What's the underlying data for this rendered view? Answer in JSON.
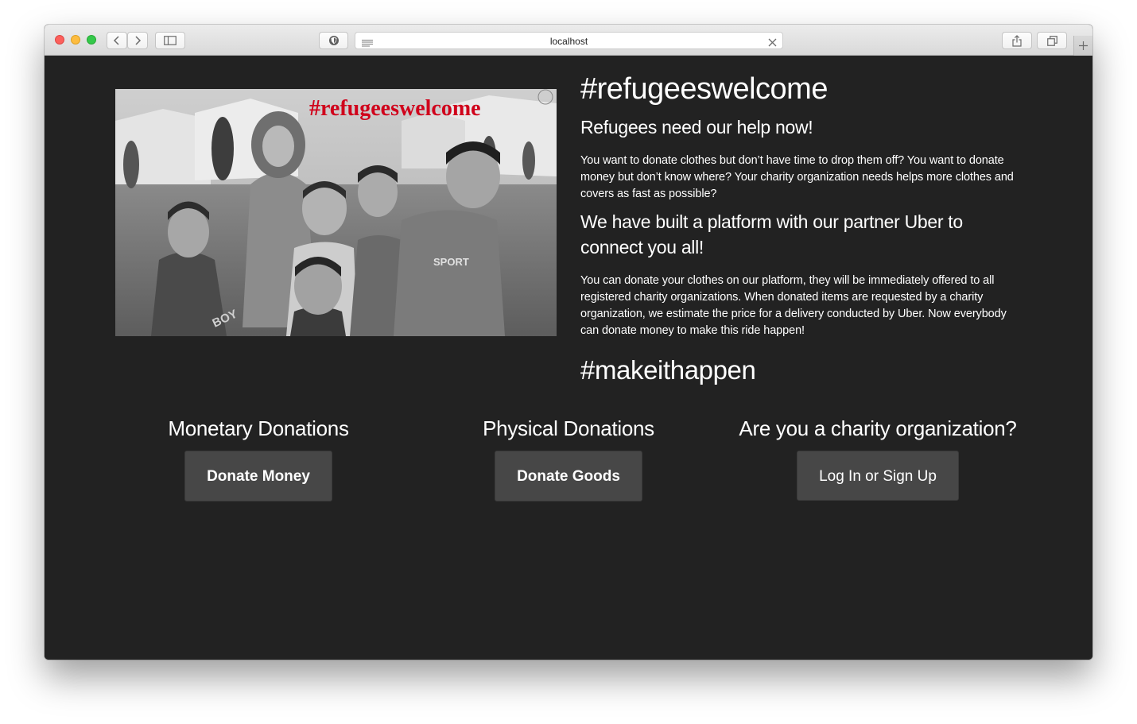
{
  "browser": {
    "url": "localhost"
  },
  "hero": {
    "image_overlay_text": "#refugeeswelcome",
    "shirt_text_1": "SPORT",
    "shirt_text_2": "BOY"
  },
  "intro": {
    "title": "#refugeeswelcome",
    "subtitle": "Refugees need our help now!",
    "paragraph1": "You want to donate clothes but don’t have time to drop them off? You want to donate money but don’t know where? Your charity organization needs helps more clothes and covers as fast as possible?",
    "subtitle2": "We have built a platform with our partner Uber to connect you all!",
    "paragraph2": "You can donate your clothes on our platform, they will be immediately offered to all registered charity organizations. When donated items are requested by a charity organization, we estimate the price for a delivery conducted by Uber. Now everybody can donate money to make this ride happen!",
    "hashtag": "#makeithappen"
  },
  "sections": {
    "monetary": {
      "title": "Monetary Donations",
      "button": "Donate Money"
    },
    "physical": {
      "title": "Physical Donations",
      "button": "Donate Goods"
    },
    "charity": {
      "title": "Are you a charity organization?",
      "button": "Log In or Sign Up"
    }
  },
  "colors": {
    "background": "#222222",
    "button": "#474747",
    "overlay_red": "#d0021b"
  }
}
